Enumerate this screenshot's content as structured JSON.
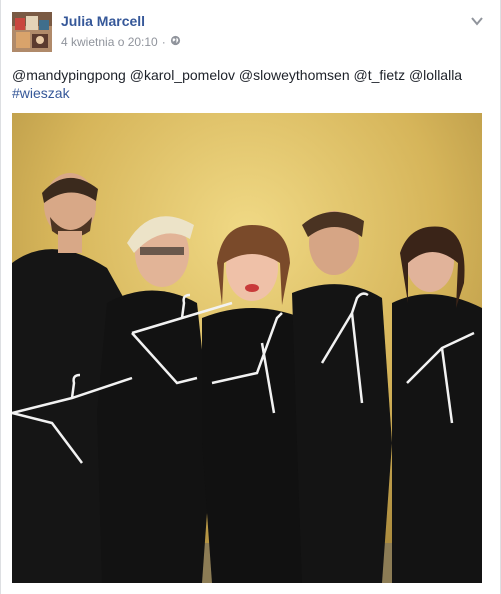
{
  "post": {
    "author": "Julia Marcell",
    "timestamp": "4 kwietnia o 20:10",
    "separator": "·",
    "audience_icon": "globe-icon",
    "menu_icon": "chevron-down-icon",
    "mentions": [
      "@mandypingpong",
      "@karol_pomelov",
      "@sloweythomsen",
      "@t_fietz",
      "@lollalla"
    ],
    "hashtag": "#wieszak",
    "photo": {
      "subject": "five people in black holding wire clothes hangers",
      "background_color": "#d9b75a"
    }
  },
  "colors": {
    "link": "#365899",
    "meta": "#90949c",
    "text": "#1d2129"
  }
}
